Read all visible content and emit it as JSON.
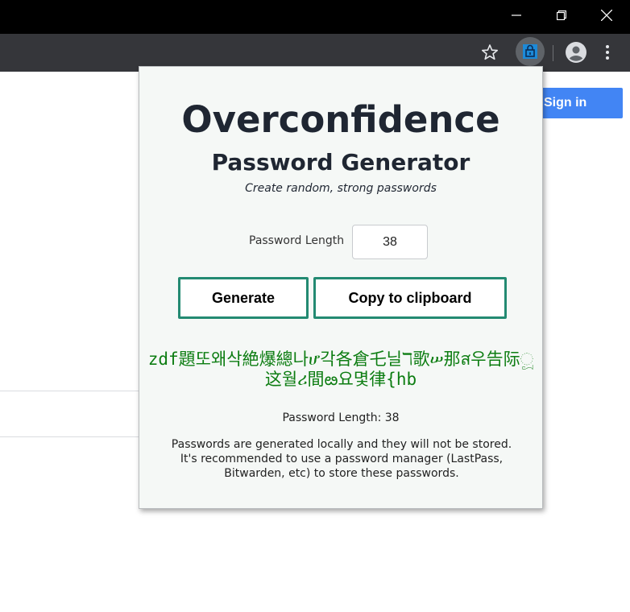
{
  "browser": {
    "window_controls": {
      "minimize": "minimize-icon",
      "restore": "restore-icon",
      "close": "close-icon"
    },
    "toolbar": {
      "bookmark_icon": "star-icon",
      "extension_icon": "lock-icon",
      "profile_icon": "avatar-icon",
      "menu_icon": "more-vert-icon"
    }
  },
  "page": {
    "signin_label": "Sign in",
    "signin_color": "#4285f4"
  },
  "popup": {
    "title": "Overconfidence",
    "subtitle": "Password Generator",
    "tagline": "Create random, strong passwords",
    "length_label": "Password Length",
    "length_value": "38",
    "generate_label": "Generate",
    "copy_label": "Copy to clipboard",
    "password": "zdf題또왜삭絶爆總나ሆ각各倉乇닐ℸ歌ሠ那ส우告际ූ这월ሪ間ఴ요몇律{hb",
    "length_readout": "Password Length: 38",
    "notice_line1": "Passwords are generated locally and they will not be stored.",
    "notice_line2": "It's recommended to use a password manager (LastPass, Bitwarden, etc) to store these passwords.",
    "accent_color": "#238a72",
    "password_color": "#0d7d12"
  }
}
